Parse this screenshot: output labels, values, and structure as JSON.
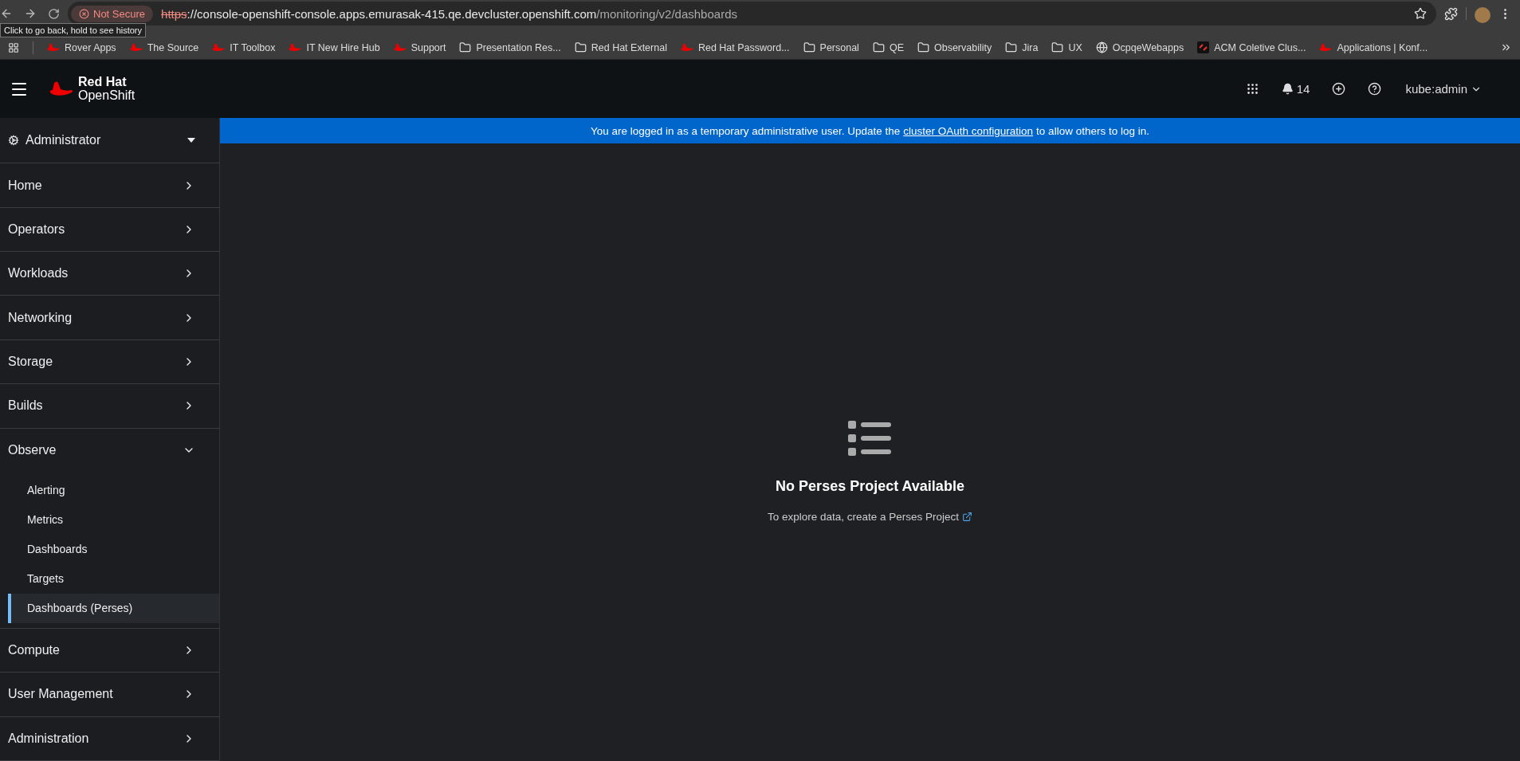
{
  "browser": {
    "tooltip": "Click to go back, hold to see history",
    "security": "Not Secure",
    "url": {
      "scheme": "https",
      "rest": "://",
      "host": "console-openshift-console.apps.emurasak-415.qe.devcluster.openshift.com",
      "path": "/monitoring/v2/dashboards"
    },
    "bookmarks": [
      {
        "kind": "redhat",
        "label": "Rover Apps"
      },
      {
        "kind": "redhat",
        "label": "The Source"
      },
      {
        "kind": "redhat",
        "label": "IT Toolbox"
      },
      {
        "kind": "redhat",
        "label": "IT New Hire Hub"
      },
      {
        "kind": "redhat",
        "label": "Support"
      },
      {
        "kind": "folder",
        "label": "Presentation Res..."
      },
      {
        "kind": "folder",
        "label": "Red Hat External"
      },
      {
        "kind": "redhat",
        "label": "Red Hat Password..."
      },
      {
        "kind": "folder",
        "label": "Personal"
      },
      {
        "kind": "folder",
        "label": "QE"
      },
      {
        "kind": "folder",
        "label": "Observability"
      },
      {
        "kind": "folder",
        "label": "Jira"
      },
      {
        "kind": "folder",
        "label": "UX"
      },
      {
        "kind": "globe",
        "label": "OcpqeWebapps"
      },
      {
        "kind": "app",
        "label": "ACM Coletive Clus..."
      },
      {
        "kind": "redhat",
        "label": "Applications | Konf..."
      }
    ]
  },
  "masthead": {
    "brand_top": "Red Hat",
    "brand_bottom": "OpenShift",
    "notifications": "14",
    "user": "kube:admin"
  },
  "banner": {
    "before": "You are logged in as a temporary administrative user. Update the",
    "link": "cluster OAuth configuration",
    "after": "to allow others to log in."
  },
  "sidebar": {
    "perspective": "Administrator",
    "items": [
      {
        "label": "Home",
        "expanded": false
      },
      {
        "label": "Operators",
        "expanded": false
      },
      {
        "label": "Workloads",
        "expanded": false
      },
      {
        "label": "Networking",
        "expanded": false
      },
      {
        "label": "Storage",
        "expanded": false
      },
      {
        "label": "Builds",
        "expanded": false
      },
      {
        "label": "Observe",
        "expanded": true,
        "children": [
          {
            "label": "Alerting",
            "selected": false
          },
          {
            "label": "Metrics",
            "selected": false
          },
          {
            "label": "Dashboards",
            "selected": false
          },
          {
            "label": "Targets",
            "selected": false
          },
          {
            "label": "Dashboards (Perses)",
            "selected": true
          }
        ]
      },
      {
        "label": "Compute",
        "expanded": false
      },
      {
        "label": "User Management",
        "expanded": false
      },
      {
        "label": "Administration",
        "expanded": false
      }
    ]
  },
  "empty_state": {
    "title": "No Perses Project Available",
    "text": "To explore data, create a Perses Project"
  }
}
